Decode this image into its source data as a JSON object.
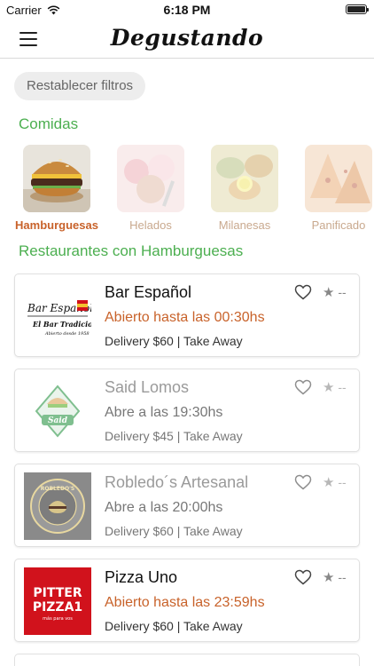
{
  "status_bar": {
    "carrier": "Carrier",
    "time": "6:18 PM",
    "battery_level": 1.0
  },
  "nav": {
    "title": "Degustando",
    "menu_icon": "hamburger-menu-icon"
  },
  "filters": {
    "reset_label": "Restablecer filtros"
  },
  "comidas": {
    "title": "Comidas",
    "categories": [
      {
        "label": "Hamburguesas",
        "active": true,
        "image": "burger"
      },
      {
        "label": "Helados",
        "active": false,
        "image": "ice-cream"
      },
      {
        "label": "Milanesas",
        "active": false,
        "image": "milanesa"
      },
      {
        "label": "Panificado",
        "active": false,
        "image": "bread"
      }
    ]
  },
  "restaurants": {
    "title": "Restaurantes con Hamburguesas",
    "items": [
      {
        "name": "Bar Español",
        "hours": "Abierto hasta las 00:30hs",
        "info": "Delivery $60 | Take Away",
        "open": true,
        "rating": "--",
        "logo": {
          "line1": "Bar Español",
          "line2": "El Bar Tradicional",
          "line3": "Abierto desde 1958"
        }
      },
      {
        "name": "Said Lomos",
        "hours": "Abre a las 19:30hs",
        "info": "Delivery $45 | Take Away",
        "open": false,
        "rating": "--",
        "logo": {
          "text": "Said"
        }
      },
      {
        "name": "Robledo´s Artesanal",
        "hours": "Abre a las 20:00hs",
        "info": "Delivery $60 | Take Away",
        "open": false,
        "rating": "--",
        "logo": {
          "text": "ROBLEDO'S"
        }
      },
      {
        "name": "Pizza Uno",
        "hours": "Abierto hasta las 23:59hs",
        "info": "Delivery $60 | Take Away",
        "open": true,
        "rating": "--",
        "logo": {
          "line1": "PITTER",
          "line2": "PIZZA1",
          "line3": "más para vos"
        }
      }
    ]
  },
  "colors": {
    "accent_green": "#4caf50",
    "accent_orange": "#c8622a",
    "logo_red": "#d1121c"
  }
}
